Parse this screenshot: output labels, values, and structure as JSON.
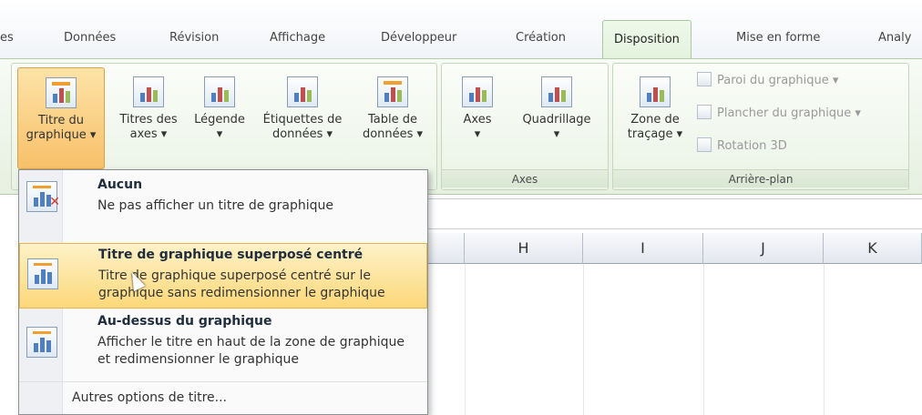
{
  "tabs": [
    {
      "label": "es",
      "active": false
    },
    {
      "label": "Données",
      "active": false
    },
    {
      "label": "Révision",
      "active": false
    },
    {
      "label": "Affichage",
      "active": false
    },
    {
      "label": "Développeur",
      "active": false
    },
    {
      "label": "Création",
      "active": false
    },
    {
      "label": "Disposition",
      "active": true
    },
    {
      "label": "Mise en forme",
      "active": false
    },
    {
      "label": "Analy",
      "active": false
    }
  ],
  "ribbon": {
    "chart_title": {
      "line1": "Titre du",
      "line2": "graphique ▾"
    },
    "axis_titles": {
      "line1": "Titres des",
      "line2": "axes ▾"
    },
    "legend": {
      "line1": "Légende",
      "line2": "▾"
    },
    "data_labels": {
      "line1": "Étiquettes de",
      "line2": "données ▾"
    },
    "data_table": {
      "line1": "Table de",
      "line2": "données ▾"
    },
    "axes": {
      "line1": "Axes",
      "line2": "▾"
    },
    "gridlines": {
      "line1": "Quadrillage",
      "line2": "▾"
    },
    "group_axes": "Axes",
    "plot_area": {
      "line1": "Zone de",
      "line2": "traçage ▾"
    },
    "chart_wall": "Paroi du graphique ▾",
    "chart_floor": "Plancher du graphique ▾",
    "rotation_3d": "Rotation 3D",
    "group_background": "Arrière-plan"
  },
  "columns": [
    "H",
    "I",
    "J",
    "K"
  ],
  "menu": {
    "items": [
      {
        "title": "Aucun",
        "desc": "Ne pas afficher un titre de graphique"
      },
      {
        "title": "Titre de graphique superposé centré",
        "desc": "Titre de graphique superposé centré sur le graphique sans redimensionner le graphique"
      },
      {
        "title": "Au-dessus du graphique",
        "desc": "Afficher le titre en haut de la zone de graphique et redimensionner le graphique"
      }
    ],
    "more": "Autres options de titre..."
  }
}
